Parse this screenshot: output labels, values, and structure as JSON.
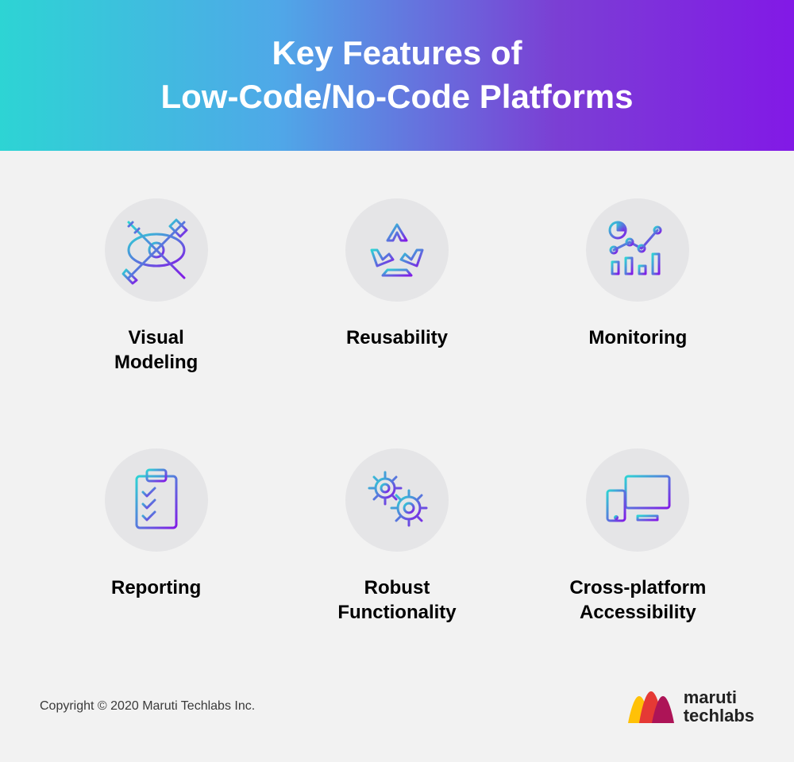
{
  "header": {
    "title": "Key Features of\nLow-Code/No-Code Platforms"
  },
  "features": [
    {
      "label": "Visual\nModeling"
    },
    {
      "label": "Reusability"
    },
    {
      "label": "Monitoring"
    },
    {
      "label": "Reporting"
    },
    {
      "label": "Robust\nFunctionality"
    },
    {
      "label": "Cross-platform\nAccessibility"
    }
  ],
  "footer": {
    "copyright": "Copyright © 2020 Maruti Techlabs Inc.",
    "brand_line1": "maruti",
    "brand_line2": "techlabs"
  },
  "colors": {
    "gradient_start": "#2dd4d4",
    "gradient_mid": "#4fa8e8",
    "gradient_end": "#8219e6"
  }
}
